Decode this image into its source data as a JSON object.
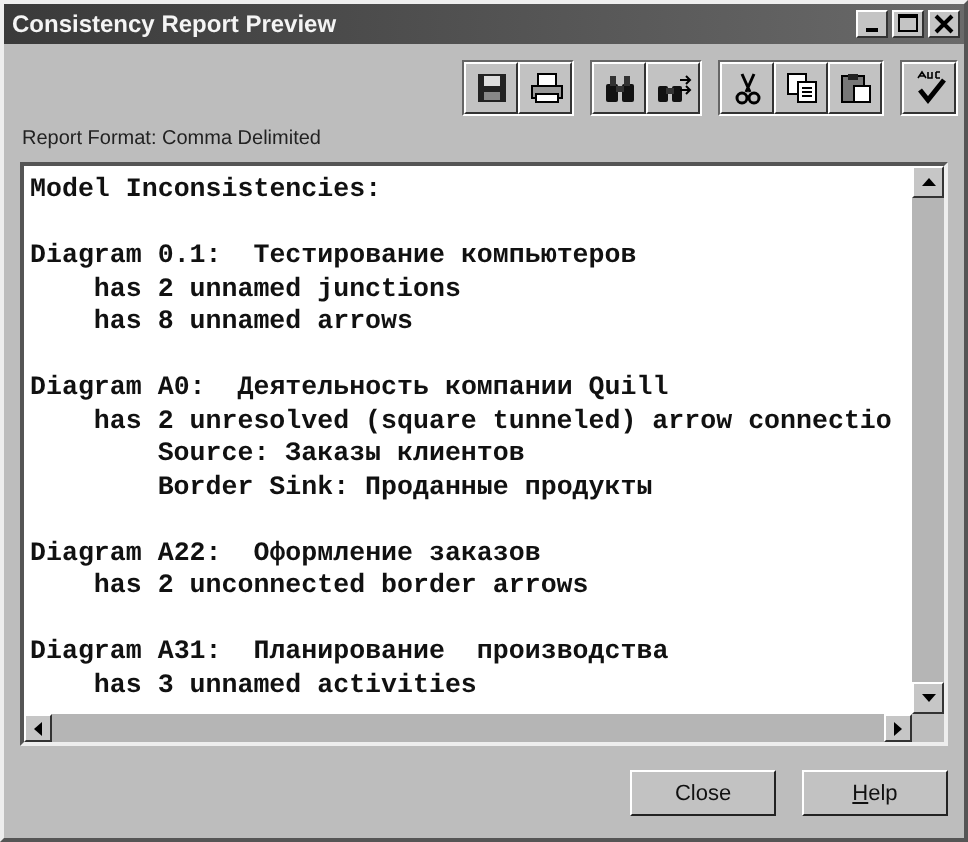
{
  "window": {
    "title": "Consistency Report Preview"
  },
  "report_format": "Report Format: Comma Delimited",
  "report": {
    "heading": "Model Inconsistencies:",
    "diagrams": [
      {
        "title": "Diagram 0.1:  Тестирование компьютеров",
        "issues": [
          {
            "text": "has 2 unnamed junctions"
          },
          {
            "text": "has 8 unnamed arrows"
          }
        ]
      },
      {
        "title": "Diagram A0:  Деятельность компании Quill",
        "issues": [
          {
            "text": "has 2 unresolved (square tunneled) arrow connectio",
            "children": [
              {
                "text": "Source: Заказы клиентов"
              },
              {
                "text": "Border Sink: Проданные продукты"
              }
            ]
          }
        ]
      },
      {
        "title": "Diagram A22:  Оформление заказов",
        "issues": [
          {
            "text": "has 2 unconnected border arrows"
          }
        ]
      },
      {
        "title": "Diagram A31:  Планирование  производства",
        "issues": [
          {
            "text": "has 3 unnamed activities"
          }
        ]
      }
    ]
  },
  "buttons": [
    "Close",
    "Help"
  ]
}
